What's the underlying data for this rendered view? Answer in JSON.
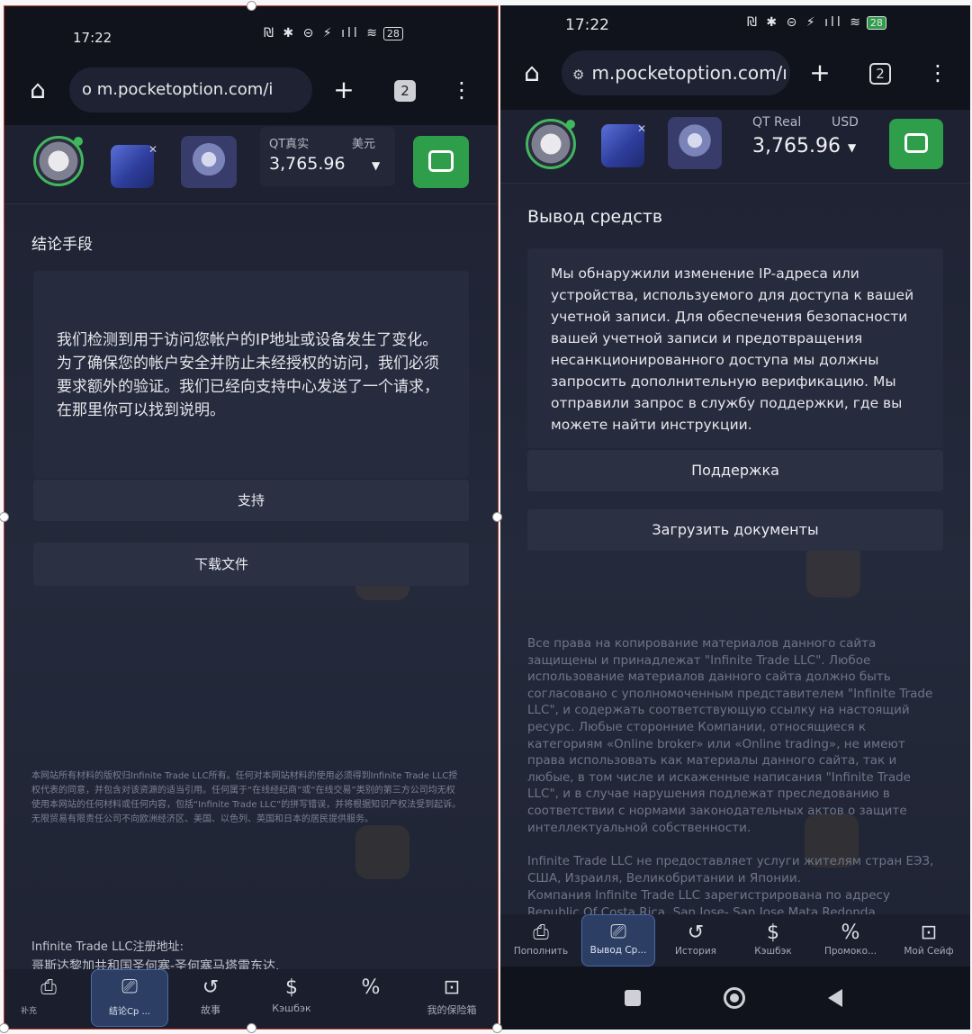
{
  "left": {
    "status": {
      "time": "17:22",
      "icons": "₪ ✱ ⊝ ⚡ ıll ≋",
      "battery": "28"
    },
    "browser": {
      "url": "o m.pocketoption.com/i",
      "tabs": "2",
      "home_icon": "home-icon",
      "add_icon": "plus-icon",
      "menu_icon": "more-vert-icon"
    },
    "account": {
      "type": "QT真实",
      "currency": "美元",
      "balance": "3,765.96"
    },
    "page_title": "结论手段",
    "message": "我们检测到用于访问您帐户的IP地址或设备发生了变化。为了确保您的帐户安全并防止未经授权的访问，我们必须要求额外的验证。我们已经向支持中心发送了一个请求，在那里你可以找到说明。",
    "buttons": {
      "support": "支持",
      "upload": "下载文件"
    },
    "legal": "本网站所有材料的版权归Infinite Trade LLC所有。任何对本网站材料的使用必须得到Infinite Trade LLC授权代表的同意，并包含对该资源的适当引用。任何属于“在线经纪商”或“在线交易”类别的第三方公司均无权使用本网站的任何材料或任何内容，包括“Infinite Trade LLC”的拼写错误，并将根据知识产权法受到起诉。无限贸易有限责任公司不向欧洲经济区、美国、以色列、英国和日本的居民提供服务。",
    "address": {
      "label": "Infinite Trade LLC注册地址:",
      "value": "哥斯达黎加共和国圣何塞-圣何塞马塔雷东达,"
    },
    "tabs_bar": [
      {
        "label": "补充",
        "icon": "deposit-icon"
      },
      {
        "label": "结论Cp ...",
        "icon": "withdraw-icon"
      },
      {
        "label": "故事",
        "icon": "history-icon"
      },
      {
        "label": "Кэшбэк",
        "icon": "cashback-icon"
      },
      {
        "label": "",
        "icon": "promo-icon"
      },
      {
        "label": "我的保险箱",
        "icon": "safe-icon"
      }
    ]
  },
  "right": {
    "status": {
      "time": "17:22",
      "icons": "₪ ✱ ⊝ ⚡ ıll ≋",
      "battery": "28"
    },
    "browser": {
      "url": "m.pocketoption.com/ı",
      "tabs": "2",
      "home_icon": "home-icon",
      "add_icon": "plus-icon",
      "menu_icon": "more-vert-icon"
    },
    "account": {
      "type": "QT Real",
      "currency": "USD",
      "balance": "3,765.96"
    },
    "page_title": "Вывод средств",
    "message": "Мы обнаружили изменение IP-адреса или устройства, используемого для доступа к вашей учетной записи. Для обеспечения безопасности вашей учетной записи и предотвращения несанкционированного доступа мы должны запросить дополнительную верификацию. Мы отправили запрос в службу поддержки, где вы можете найти инструкции.",
    "buttons": {
      "support": "Поддержка",
      "upload": "Загрузить документы"
    },
    "legal": "Все права на копирование материалов данного сайта защищены и принадлежат \"Infinite Trade LLC\". Любое использование материалов данного сайта должно быть согласовано с уполномоченным представителем \"Infinite Trade LLC\", и содержать соответствующую ссылку на настоящий ресурс. Любые сторонние Компании, относящиеся к категориям «Online broker» или «Online trading», не имеют права использовать как материалы данного сайта, так и любые, в том числе и искаженные написания \"Infinite Trade LLC\", и в случае нарушения подлежат преследованию в соответствии с нормами законодательных актов о защите интеллектуальной собственности.",
    "legal2": "Infinite Trade LLC не предоставляет услуги жителям стран ЕЭЗ, США, Израиля, Великобритании и Японии.",
    "legal3": "Компания Infinite Trade LLC зарегистрирована по адресу Republic Of Costa Rica, San Jose- San Jose Mata Redonda,",
    "tabs_bar": [
      {
        "label": "Пополнить",
        "icon": "deposit-icon"
      },
      {
        "label": "Вывод Ср...",
        "icon": "withdraw-icon"
      },
      {
        "label": "История",
        "icon": "history-icon"
      },
      {
        "label": "Кэшбэк",
        "icon": "cashback-icon"
      },
      {
        "label": "Промоко...",
        "icon": "promo-icon"
      },
      {
        "label": "Мой Сейф",
        "icon": "safe-icon"
      }
    ]
  },
  "colors": {
    "accent_green": "#2e9e4a",
    "active_tab": "#2c3e63",
    "background": "#1f2334"
  }
}
